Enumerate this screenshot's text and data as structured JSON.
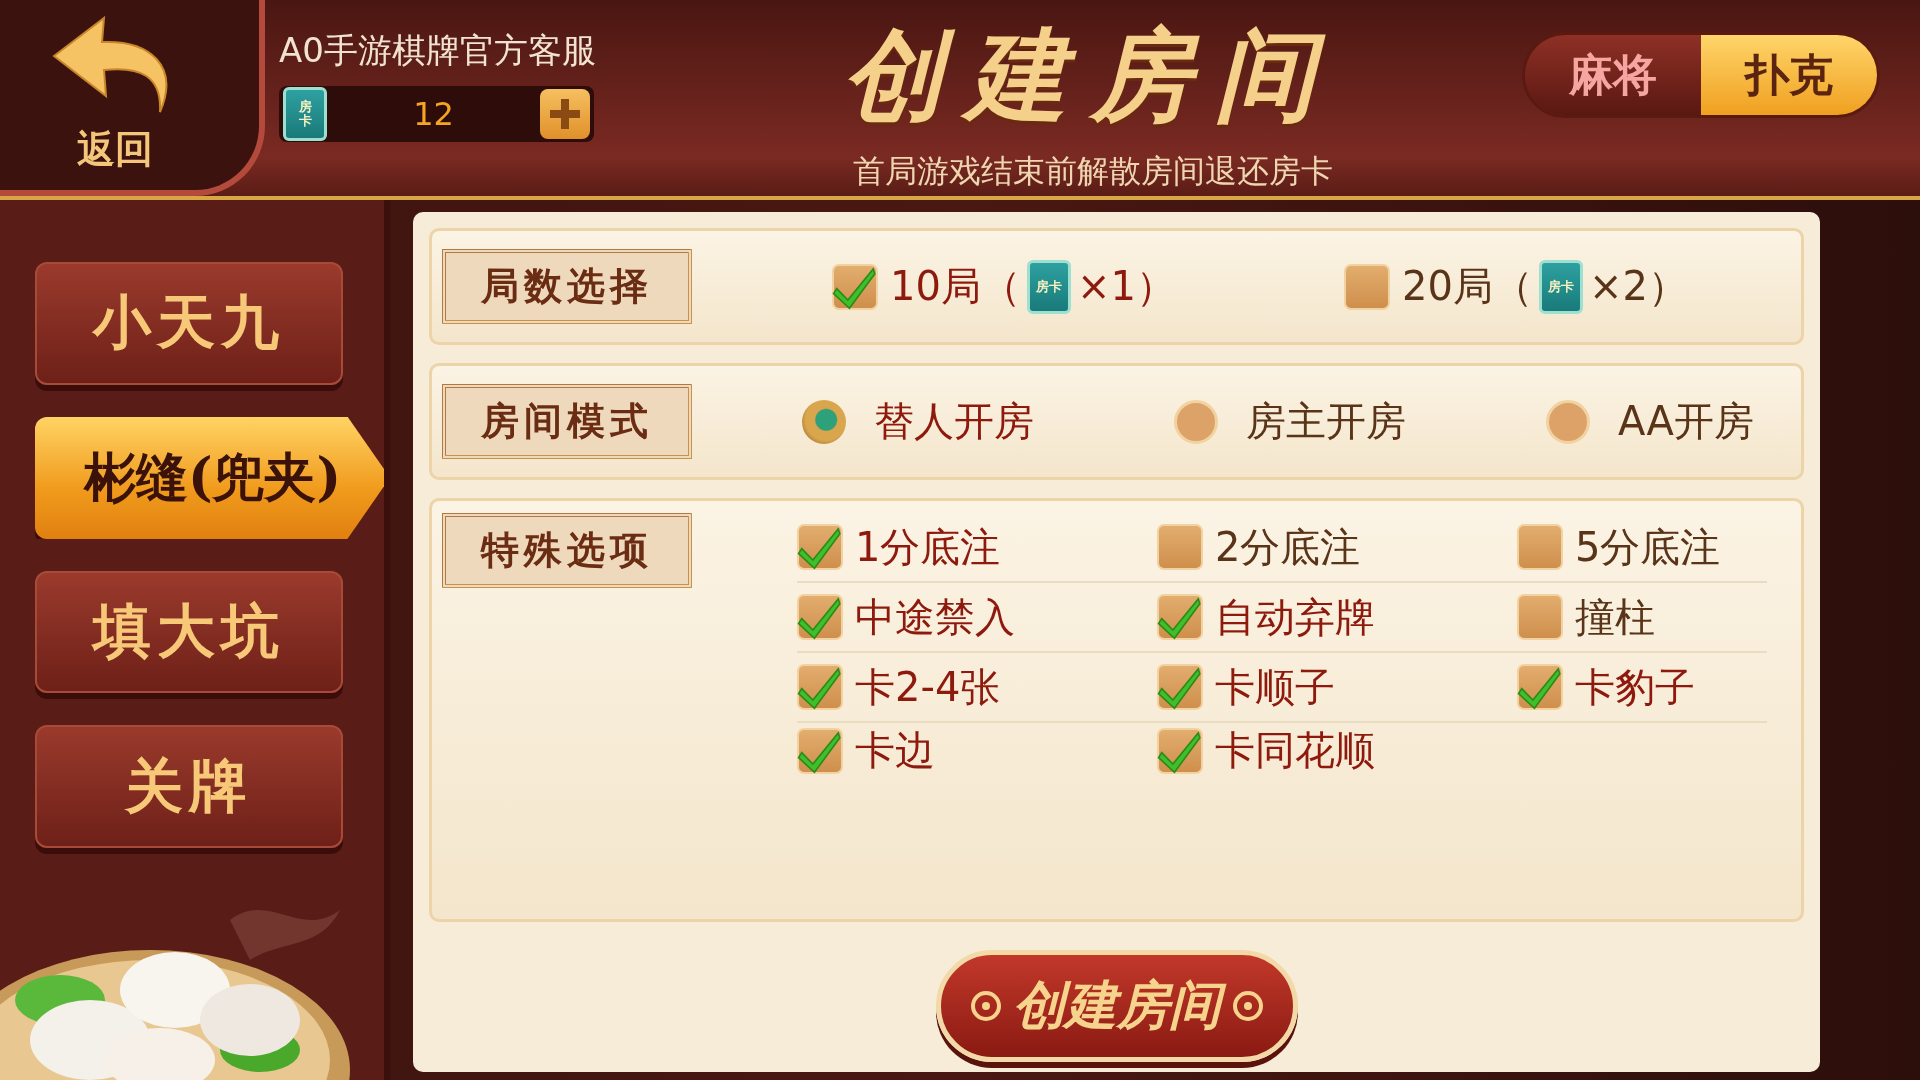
{
  "header": {
    "back_label": "返回",
    "service_name": "A0手游棋牌官方客服",
    "card_label": "房卡",
    "card_count": "12",
    "title": "创建房间",
    "notice": "首局游戏结束前解散房间退还房卡"
  },
  "game_types": [
    {
      "label": "麻将",
      "selected": false
    },
    {
      "label": "扑克",
      "selected": true
    }
  ],
  "games": [
    {
      "label": "小天九",
      "selected": false
    },
    {
      "label": "彬缝(兜夹)",
      "selected": true
    },
    {
      "label": "填大坑",
      "selected": false
    },
    {
      "label": "关牌",
      "selected": false
    }
  ],
  "sections": [
    {
      "title": "局数选择",
      "kind": "rounds",
      "options": [
        {
          "label": "10局（",
          "card_label": "房卡",
          "suffix": "×1）",
          "checked": true
        },
        {
          "label": "20局（",
          "card_label": "房卡",
          "suffix": "×2）",
          "checked": false
        }
      ]
    },
    {
      "title": "房间模式",
      "kind": "radio",
      "options": [
        {
          "label": "替人开房",
          "selected": true
        },
        {
          "label": "房主开房",
          "selected": false
        },
        {
          "label": "AA开房",
          "selected": false
        }
      ]
    },
    {
      "title": "特殊选项",
      "kind": "check",
      "options": [
        {
          "label": "1分底注",
          "checked": true
        },
        {
          "label": "2分底注",
          "checked": false
        },
        {
          "label": "5分底注",
          "checked": false
        },
        {
          "label": "中途禁入",
          "checked": true
        },
        {
          "label": "自动弃牌",
          "checked": true
        },
        {
          "label": "撞柱",
          "checked": false
        },
        {
          "label": "卡2-4张",
          "checked": true
        },
        {
          "label": "卡顺子",
          "checked": true
        },
        {
          "label": "卡豹子",
          "checked": true
        },
        {
          "label": "卡边",
          "checked": true
        },
        {
          "label": "卡同花顺",
          "checked": true
        }
      ]
    }
  ],
  "create_button": "创建房间"
}
